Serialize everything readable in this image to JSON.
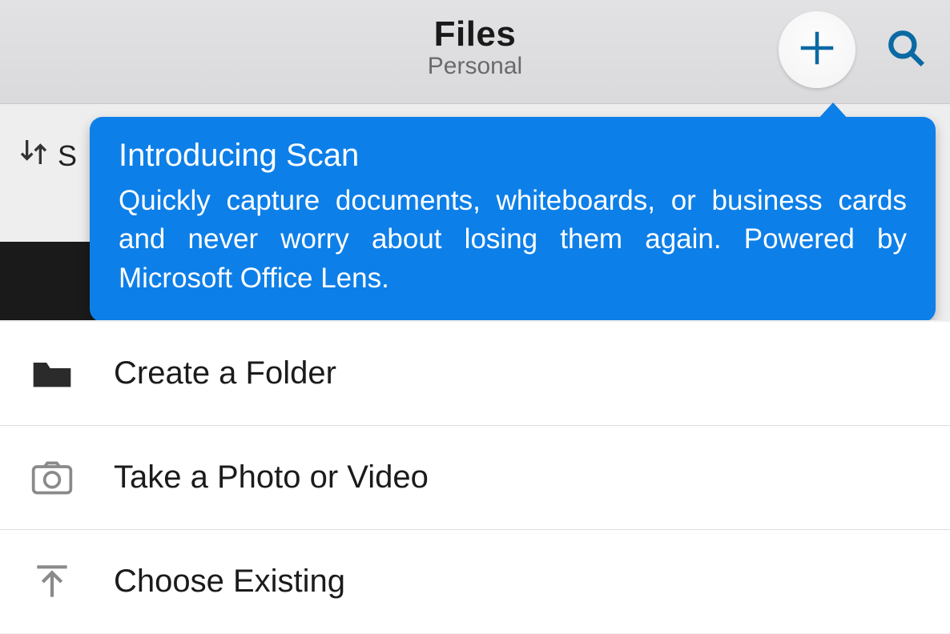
{
  "header": {
    "title": "Files",
    "subtitle": "Personal"
  },
  "sort": {
    "prefix": "S"
  },
  "callout": {
    "title": "Introducing Scan",
    "body": "Quickly capture documents, whiteboards, or business cards and never worry about losing them again. Powered by Microsoft Office Lens."
  },
  "menu": {
    "items": [
      {
        "label": "Create a Folder"
      },
      {
        "label": "Take a Photo or Video"
      },
      {
        "label": "Choose Existing"
      }
    ]
  }
}
